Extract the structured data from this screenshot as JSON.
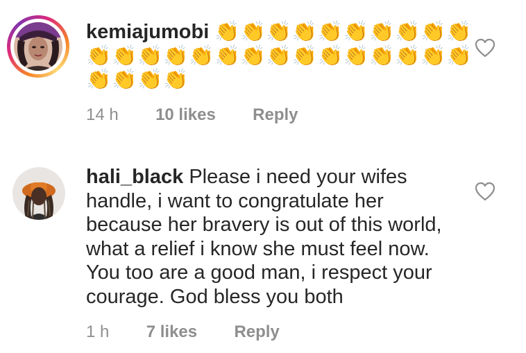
{
  "comments": [
    {
      "username": "kemiajumobi",
      "text_line1": "👏👏👏👏👏👏👏👏👏👏",
      "text_line2": "👏👏👏👏👏👏👏👏👏👏👏👏👏👏👏",
      "text_line3": "👏👏👏👏",
      "time": "14 h",
      "likes": "10 likes",
      "reply_label": "Reply",
      "avatar_icon": "profile-photo"
    },
    {
      "username": "hali_black",
      "text_lines": [
        "Please i need your wifes",
        "handle, i want to congratulate her",
        "because her bravery is out of this world,",
        "what a relief i know she must feel now.",
        "You too are a good man, i respect your",
        "courage. God bless you both"
      ],
      "time": "1 h",
      "likes": "7 likes",
      "reply_label": "Reply",
      "avatar_icon": "profile-photo"
    }
  ],
  "colors": {
    "text": "#262626",
    "meta": "#8e8e8e",
    "heart_stroke": "#8e8e8e"
  },
  "icons": {
    "like": "heart-outline-icon"
  }
}
